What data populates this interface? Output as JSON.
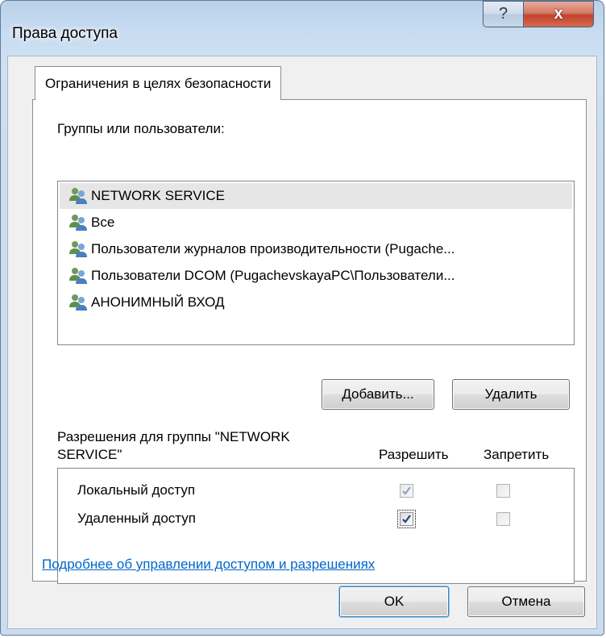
{
  "window": {
    "title": "Права доступа",
    "help_label": "?",
    "close_label": "x"
  },
  "tab": {
    "label": "Ограничения в целях безопасности"
  },
  "groups": {
    "label": "Группы или пользователи:",
    "items": [
      {
        "name": "NETWORK SERVICE",
        "icon": "users-icon",
        "selected": true
      },
      {
        "name": "Все",
        "icon": "users-icon",
        "selected": false
      },
      {
        "name": "Пользователи журналов производительности (Pugache...",
        "icon": "users-icon",
        "selected": false
      },
      {
        "name": "Пользователи DCOM (PugachevskayaPC\\Пользователи...",
        "icon": "users-icon",
        "selected": false
      },
      {
        "name": "АНОНИМНЫЙ ВХОД",
        "icon": "users-icon",
        "selected": false
      }
    ]
  },
  "buttons": {
    "add": "Добавить...",
    "remove": "Удалить",
    "ok": "OK",
    "cancel": "Отмена"
  },
  "permissions": {
    "label_line1": "Разрешения для группы \"NETWORK",
    "label_line2": "SERVICE\"",
    "allow_header": "Разрешить",
    "deny_header": "Запретить",
    "rows": [
      {
        "label": "Локальный доступ",
        "allow": true,
        "allow_disabled": true,
        "deny": false,
        "deny_disabled": true
      },
      {
        "label": "Удаленный доступ",
        "allow": true,
        "allow_disabled": false,
        "deny": false,
        "deny_disabled": true
      }
    ]
  },
  "help_link": "Подробнее об управлении доступом и разрешениях",
  "colors": {
    "link": "#0066cc",
    "close_button": "#c0432c",
    "selection": "#e6e6e6"
  }
}
